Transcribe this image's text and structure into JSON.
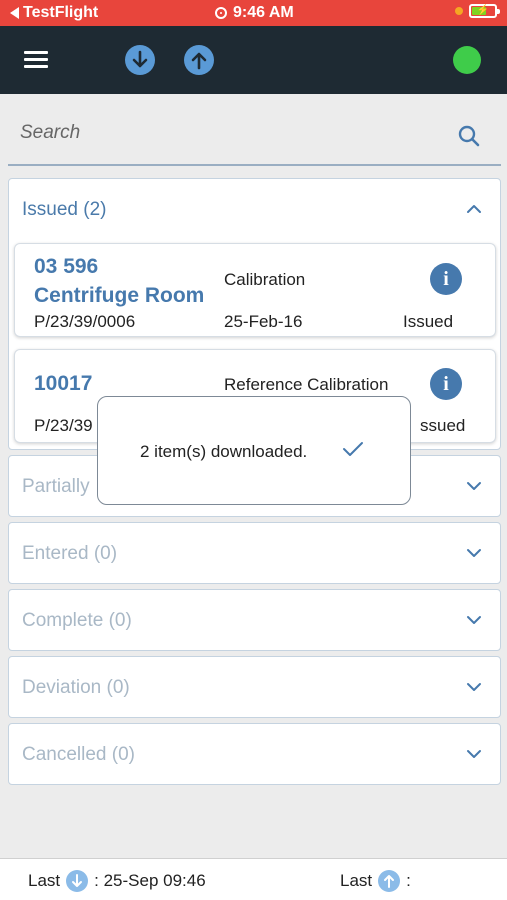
{
  "status_bar": {
    "back_app": "TestFlight",
    "time": "9:46 AM",
    "battery_color": "#7ed321",
    "background": "#e8453c"
  },
  "app_bar": {
    "background": "#1e2a33",
    "icons": [
      "menu-icon",
      "download-icon",
      "upload-icon",
      "sync-status-indicator"
    ],
    "sync_status_color": "#3fcc4a"
  },
  "search": {
    "placeholder": "Search",
    "value": ""
  },
  "sections": [
    {
      "title": "Issued (2)",
      "expanded": true,
      "items": [
        {
          "id": "03 596",
          "name": "Centrifuge Room",
          "type": "Calibration",
          "ref": "P/23/39/0006",
          "date": "25-Feb-16",
          "status": "Issued"
        },
        {
          "id": "10017",
          "name": "",
          "type": "Reference Calibration",
          "ref": "P/23/39",
          "date": "",
          "status": "ssued"
        }
      ]
    },
    {
      "title": "Partially",
      "expanded": false
    },
    {
      "title": "Entered (0)",
      "expanded": false
    },
    {
      "title": "Complete (0)",
      "expanded": false
    },
    {
      "title": "Deviation (0)",
      "expanded": false
    },
    {
      "title": "Cancelled (0)",
      "expanded": false
    }
  ],
  "toast": {
    "message": "2 item(s) downloaded."
  },
  "footer": {
    "last_label_1": "Last",
    "last_download": ": 25-Sep 09:46",
    "last_label_2": "Last",
    "last_upload": ":"
  },
  "accent_color": "#4679ad"
}
